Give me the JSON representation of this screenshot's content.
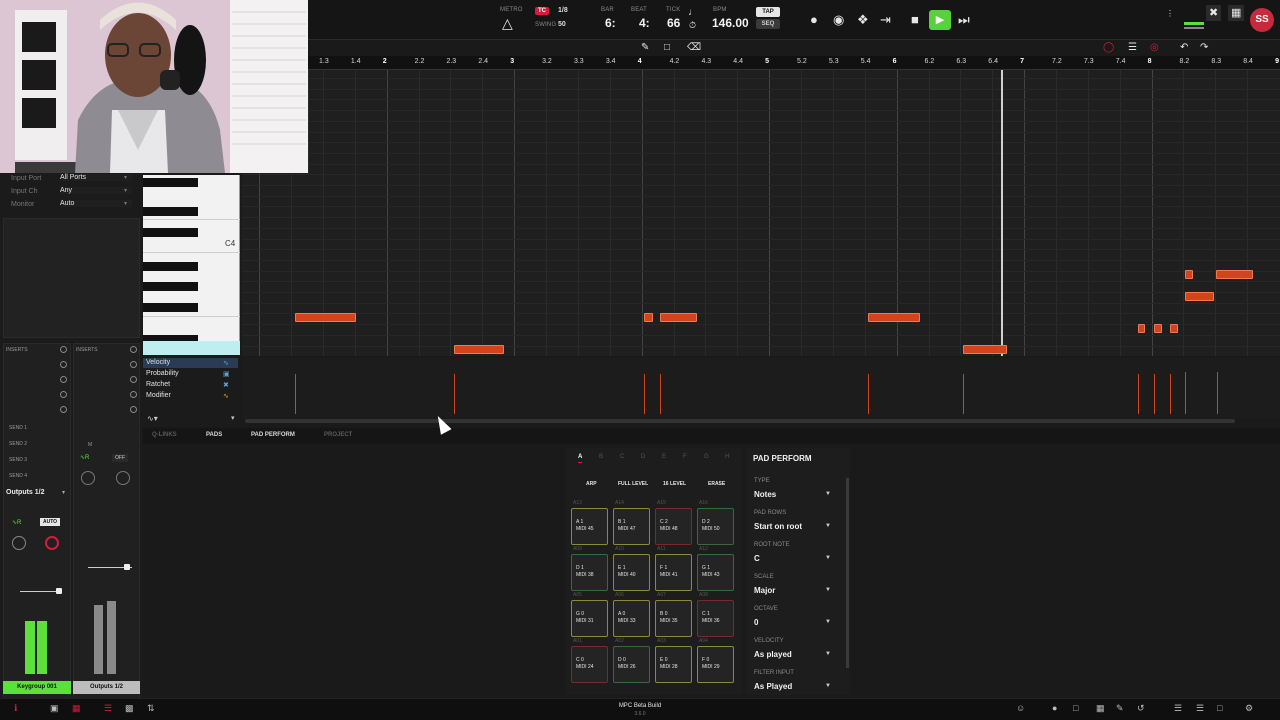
{
  "transport": {
    "metro_label": "METRO",
    "tc_label": "TC",
    "tc_value": "1/8",
    "swing_label": "SWING",
    "swing_value": "50",
    "bar_label": "BAR",
    "bar_value": "6:",
    "beat_label": "BEAT",
    "beat_value": "4:",
    "tick_label": "TICK",
    "tick_value": "66",
    "bpm_label": "BPM",
    "bpm_value": "146.00",
    "tap_label": "TAP",
    "seq_label": "SEQ",
    "user_initials": "SS"
  },
  "ruler": {
    "labels": [
      "1.3",
      "1.4",
      "2",
      "2.2",
      "2.3",
      "2.4",
      "3",
      "3.2",
      "3.3",
      "3.4",
      "4",
      "4.2",
      "4.3",
      "4.4",
      "5",
      "5.2",
      "5.3",
      "5.4",
      "6",
      "6.2",
      "6.3",
      "6.4",
      "7",
      "7.2",
      "7.3",
      "7.4",
      "8",
      "8.2",
      "8.3",
      "8.4",
      "9"
    ]
  },
  "piano": {
    "c4_label": "C4"
  },
  "input": {
    "port_label": "Input Port",
    "port_value": "All Ports",
    "ch_label": "Input Ch",
    "ch_value": "Any",
    "monitor_label": "Monitor",
    "monitor_value": "Auto"
  },
  "inserts": {
    "left": "INSERTS",
    "right": "INSERTS"
  },
  "sends": [
    "SEND 1",
    "SEND 2",
    "SEND 3",
    "SEND 4"
  ],
  "strip": {
    "m_label": "M",
    "off_label": "OFF",
    "outputs_label": "Outputs 1/2",
    "auto_label": "AUTO",
    "track_name": "Keygroup 001",
    "out_name": "Outputs 1/2"
  },
  "lanes": [
    "Velocity",
    "Probability",
    "Ratchet",
    "Modifier"
  ],
  "tabs": {
    "qlinks": "Q-LINKS",
    "pads": "PADS",
    "pad_perform": "PAD PERFORM",
    "project": "PROJECT"
  },
  "pads": {
    "banks": [
      "A",
      "B",
      "C",
      "D",
      "E",
      "F",
      "G",
      "H"
    ],
    "modes": [
      "ARP",
      "FULL LEVEL",
      "16 LEVEL",
      "ERASE"
    ],
    "grid": [
      {
        "id": "A13",
        "note": "A 1",
        "midi": "MIDI 45",
        "c": "y"
      },
      {
        "id": "A14",
        "note": "B 1",
        "midi": "MIDI 47",
        "c": "y"
      },
      {
        "id": "A15",
        "note": "C 2",
        "midi": "MIDI 48",
        "c": "r"
      },
      {
        "id": "A16",
        "note": "D 2",
        "midi": "MIDI 50",
        "c": "g"
      },
      {
        "id": "A09",
        "note": "D 1",
        "midi": "MIDI 38",
        "c": "g"
      },
      {
        "id": "A10",
        "note": "E 1",
        "midi": "MIDI 40",
        "c": "y"
      },
      {
        "id": "A11",
        "note": "F 1",
        "midi": "MIDI 41",
        "c": "y"
      },
      {
        "id": "A12",
        "note": "G 1",
        "midi": "MIDI 43",
        "c": "g"
      },
      {
        "id": "A05",
        "note": "G 0",
        "midi": "MIDI 31",
        "c": "y"
      },
      {
        "id": "A06",
        "note": "A 0",
        "midi": "MIDI 33",
        "c": "y"
      },
      {
        "id": "A07",
        "note": "B 0",
        "midi": "MIDI 35",
        "c": "y"
      },
      {
        "id": "A08",
        "note": "C 1",
        "midi": "MIDI 36",
        "c": "r"
      },
      {
        "id": "A01",
        "note": "C 0",
        "midi": "MIDI 24",
        "c": "r"
      },
      {
        "id": "A02",
        "note": "D 0",
        "midi": "MIDI 26",
        "c": "g"
      },
      {
        "id": "A03",
        "note": "E 0",
        "midi": "MIDI 28",
        "c": "y"
      },
      {
        "id": "A04",
        "note": "F 0",
        "midi": "MIDI 29",
        "c": "y"
      }
    ]
  },
  "perform": {
    "title": "PAD PERFORM",
    "type_label": "TYPE",
    "type_value": "Notes",
    "rows_label": "PAD ROWS",
    "rows_value": "Start on root",
    "root_label": "ROOT NOTE",
    "root_value": "C",
    "scale_label": "SCALE",
    "scale_value": "Major",
    "octave_label": "OCTAVE",
    "octave_value": "0",
    "velocity_label": "VELOCITY",
    "velocity_value": "As played",
    "filter_label": "FILTER INPUT",
    "filter_value": "As Played"
  },
  "footer": {
    "build_line1": "MPC Beta Build",
    "build_line2": "3.6.0"
  },
  "colors": {
    "accent": "#d81b3c",
    "note": "#d2431f",
    "play": "#58d23b",
    "meter": "#5de03a"
  }
}
